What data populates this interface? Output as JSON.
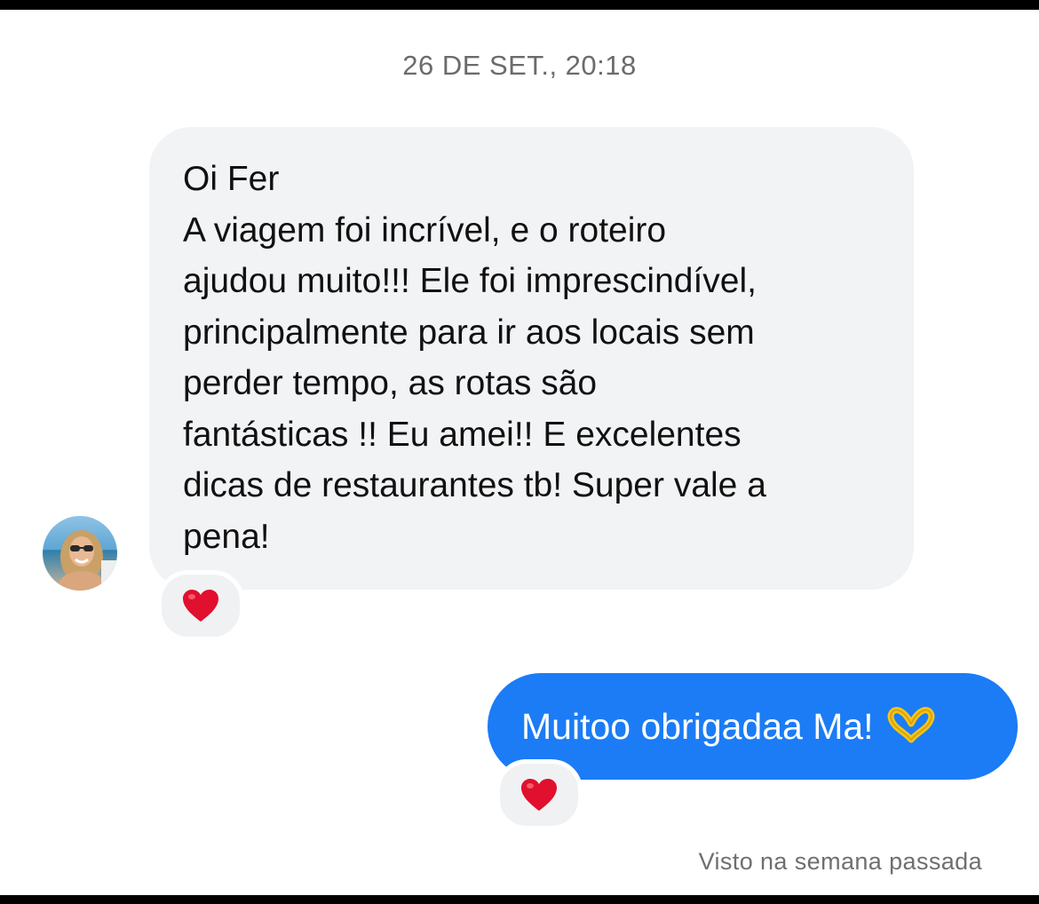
{
  "conversation": {
    "timestamp": "26 DE SET., 20:18",
    "incoming": {
      "lines": [
        "Oi Fer",
        "A viagem foi incrível, e o roteiro",
        "ajudou muito!!! Ele foi imprescindível,",
        "principalmente para ir aos locais sem",
        "perder tempo, as rotas são",
        "fantásticas !! Eu amei!! E excelentes",
        "dicas de restaurantes tb! Super vale a",
        "pena!"
      ],
      "reaction_icon": "red-heart-icon"
    },
    "outgoing": {
      "text": "Muitoo obrigadaa Ma!",
      "emoji_icon": "heart-hands-icon",
      "reaction_icon": "red-heart-icon"
    },
    "seen_status": "Visto na semana passada"
  },
  "colors": {
    "incoming_bubble": "#f2f3f5",
    "outgoing_bubble": "#1b7cf5",
    "heart": "#e0102e",
    "timestamp_text": "#6b6b6b"
  }
}
